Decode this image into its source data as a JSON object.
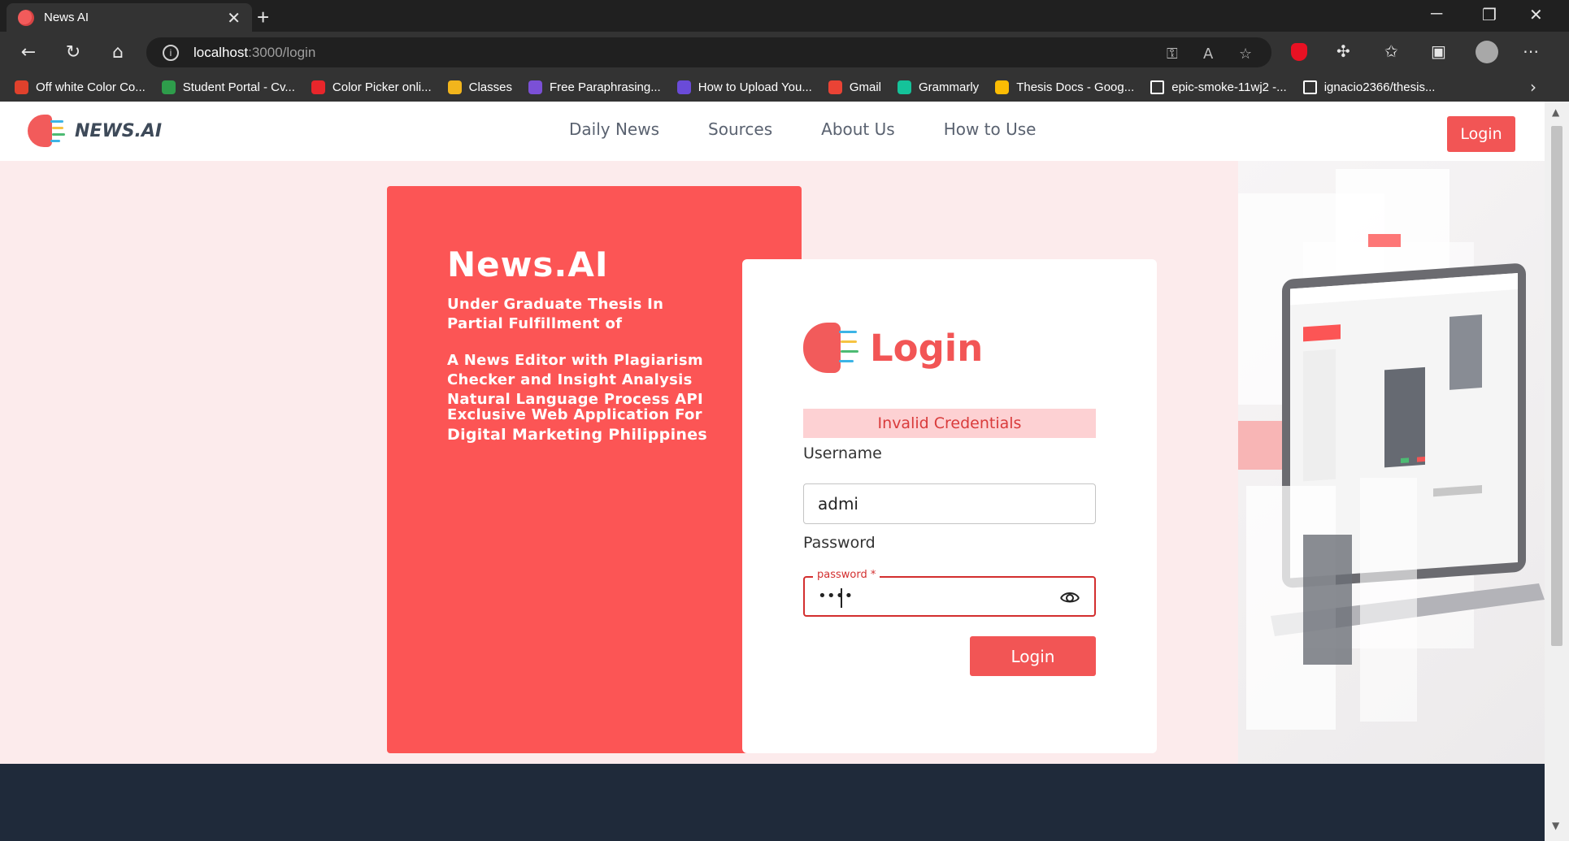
{
  "browser": {
    "tab_title": "News AI",
    "tab_close": "✕",
    "new_tab": "+",
    "url_host": "localhost",
    "url_path": ":3000/login",
    "bookmarks": [
      {
        "label": "Off white Color Co...",
        "color": "#e0412c"
      },
      {
        "label": "Student Portal - Cv...",
        "color": "#2e9d4b"
      },
      {
        "label": "Color Picker onli...",
        "color": "#e8262b"
      },
      {
        "label": "Classes",
        "color": "#f2b51c"
      },
      {
        "label": "Free Paraphrasing...",
        "color": "#7b50d6"
      },
      {
        "label": "How to Upload You...",
        "color": "#6a4bd8"
      },
      {
        "label": "Gmail",
        "color": "#ea4335"
      },
      {
        "label": "Grammarly",
        "color": "#15c39a"
      },
      {
        "label": "Thesis Docs - Goog...",
        "color": "#fbbc04"
      },
      {
        "label": "epic-smoke-11wj2 -...",
        "color": "#ffffff"
      },
      {
        "label": "ignacio2366/thesis...",
        "color": "#ffffff"
      }
    ]
  },
  "site": {
    "brand": "NEWS.AI",
    "nav": [
      "Daily News",
      "Sources",
      "About Us",
      "How to Use"
    ],
    "login_button": "Login"
  },
  "promo": {
    "title": "News.AI",
    "subtitle": "Under Graduate Thesis In Partial Fulfillment of",
    "description": "A News Editor with Plagiarism Checker and Insight Analysis Natural Language Process API",
    "exclusive": "Exclusive Web Application For",
    "company": "Digital Marketing Philippines"
  },
  "login_form": {
    "title": "Login",
    "error": "Invalid Credentials",
    "username_label": "Username",
    "username_value": "admi",
    "password_label": "Password",
    "password_floating_label": "password *",
    "password_masked": "••••",
    "submit": "Login"
  },
  "colors": {
    "accent": "#f25555",
    "panel": "#fc5555",
    "page_bg": "#fcebec",
    "footer": "#1f2a3a",
    "error_bg": "#fdd1d3"
  }
}
